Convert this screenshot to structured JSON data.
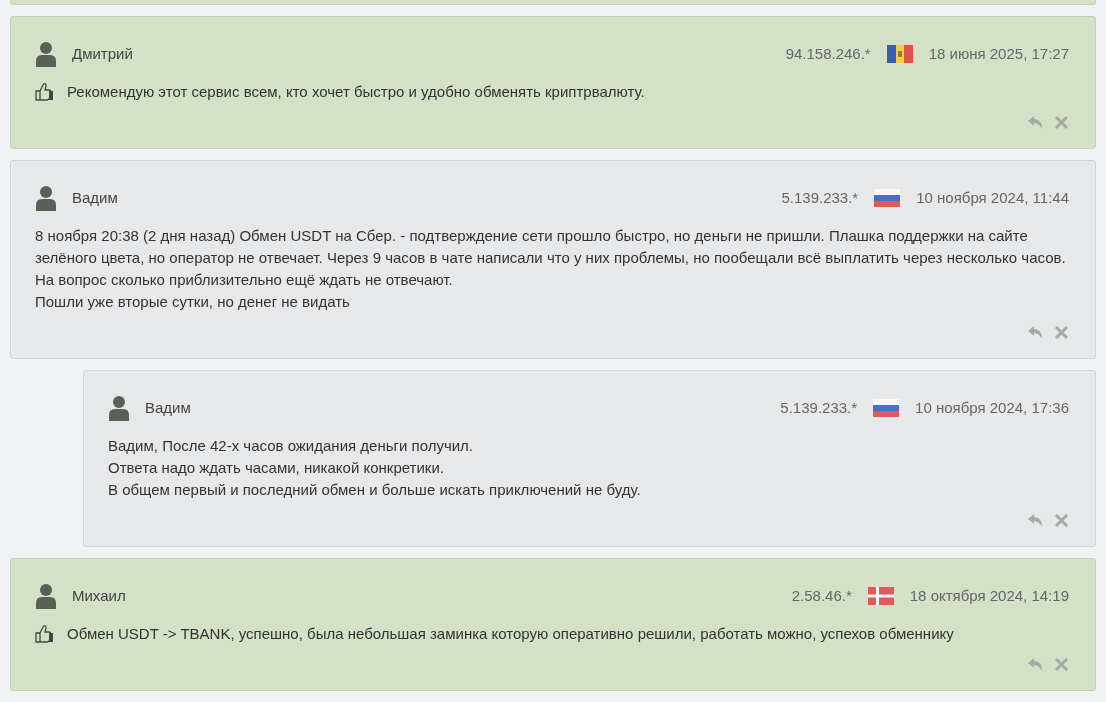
{
  "reviews": [
    {
      "kind": "positive",
      "author": "Дмитрий",
      "ip": "94.158.246.*",
      "flag": {
        "kind": "md"
      },
      "date": "18 июня 2025, 17:27",
      "lines": [
        "Рекомендую этот сервис всем, кто хочет быстро и удобно обменять криптрвалюту."
      ]
    },
    {
      "kind": "neutral",
      "author": "Вадим",
      "ip": "5.139.233.*",
      "flag": {
        "kind": "ru"
      },
      "date": "10 ноября 2024, 11:44",
      "lines": [
        "8 ноября 20:38 (2 дня назад) Обмен USDT на Сбер. - подтверждение сети прошло быстро, но деньги не пришли. Плашка поддержки на сайте зелёного цвета, но оператор не отвечает. Через 9 часов в чате написали что у них проблемы, но пообещали всё выплатить через несколько часов. На вопрос сколько приблизительно ещё ждать не отвечают.",
        "Пошли уже вторые сутки, но денег не видать"
      ],
      "children": [
        {
          "kind": "neutral",
          "author": "Вадим",
          "ip": "5.139.233.*",
          "flag": {
            "kind": "ru"
          },
          "date": "10 ноября 2024, 17:36",
          "lines": [
            "Вадим, После 42-х часов ожидания деньги получил.",
            "Ответа надо ждать часами, никакой конкретики.",
            "В общем первый и последний обмен и больше искать приключений не буду."
          ]
        }
      ]
    },
    {
      "kind": "positive",
      "author": "Михаил",
      "ip": "2.58.46.*",
      "flag": {
        "kind": "dk"
      },
      "date": "18 октября 2024, 14:19",
      "lines": [
        "Обмен USDT -> TBANK, успешно, была небольшая заминка которую оперативно решили, работать можно, успехов обменнику"
      ]
    }
  ]
}
